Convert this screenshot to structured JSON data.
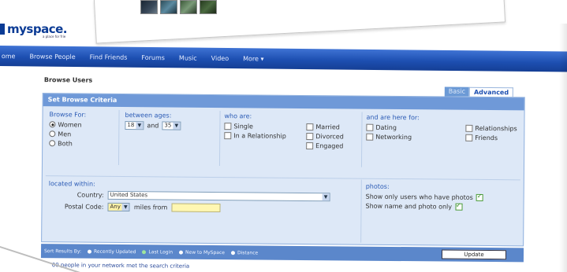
{
  "photos": [
    "photo-1",
    "photo-2",
    "photo-3",
    "photo-4"
  ],
  "logo": {
    "text": "myspace.",
    "tagline": "a place for frie"
  },
  "nav": {
    "items": [
      "ome",
      "Browse People",
      "Find Friends",
      "Forums",
      "Music",
      "Video",
      "More ▾"
    ]
  },
  "page": {
    "title": "Browse Users",
    "tabs": {
      "basic": "Basic",
      "advanced": "Advanced"
    },
    "header": "Set Browse Criteria"
  },
  "browse_for": {
    "label": "Browse For:",
    "options": [
      {
        "label": "Women",
        "selected": true
      },
      {
        "label": "Men",
        "selected": false
      },
      {
        "label": "Both",
        "selected": false
      }
    ]
  },
  "ages": {
    "label": "between ages:",
    "min": "18",
    "and_label": "and",
    "max": "35"
  },
  "who_are": {
    "label": "who are:",
    "options": [
      {
        "label": "Single",
        "checked": false
      },
      {
        "label": "Married",
        "checked": false
      },
      {
        "label": "In a Relationship",
        "checked": false
      },
      {
        "label": "Divorced",
        "checked": false
      },
      {
        "label": "Engaged",
        "checked": false
      }
    ]
  },
  "here_for": {
    "label": "and are here for:",
    "options": [
      {
        "label": "Dating",
        "checked": false
      },
      {
        "label": "Relationships",
        "checked": false
      },
      {
        "label": "Networking",
        "checked": false
      },
      {
        "label": "Friends",
        "checked": false
      }
    ]
  },
  "location": {
    "label": "located within:",
    "country_label": "Country:",
    "country_value": "United States",
    "postal_label": "Postal Code:",
    "distance_value": "Any",
    "miles_from_label": "miles from",
    "postal_value": ""
  },
  "photos_filter": {
    "label": "photos:",
    "options": [
      {
        "label": "Show only users who have photos",
        "checked": true
      },
      {
        "label": "Show name and photo only",
        "checked": true
      }
    ]
  },
  "sort": {
    "label": "Sort Results By:",
    "options": [
      {
        "label": "Recently Updated",
        "selected": false
      },
      {
        "label": "Last Login",
        "selected": true
      },
      {
        "label": "New to MySpace",
        "selected": false
      },
      {
        "label": "Distance",
        "selected": false
      }
    ],
    "update_button": "Update"
  },
  "result_text": "'00 people in your network met the search criteria"
}
